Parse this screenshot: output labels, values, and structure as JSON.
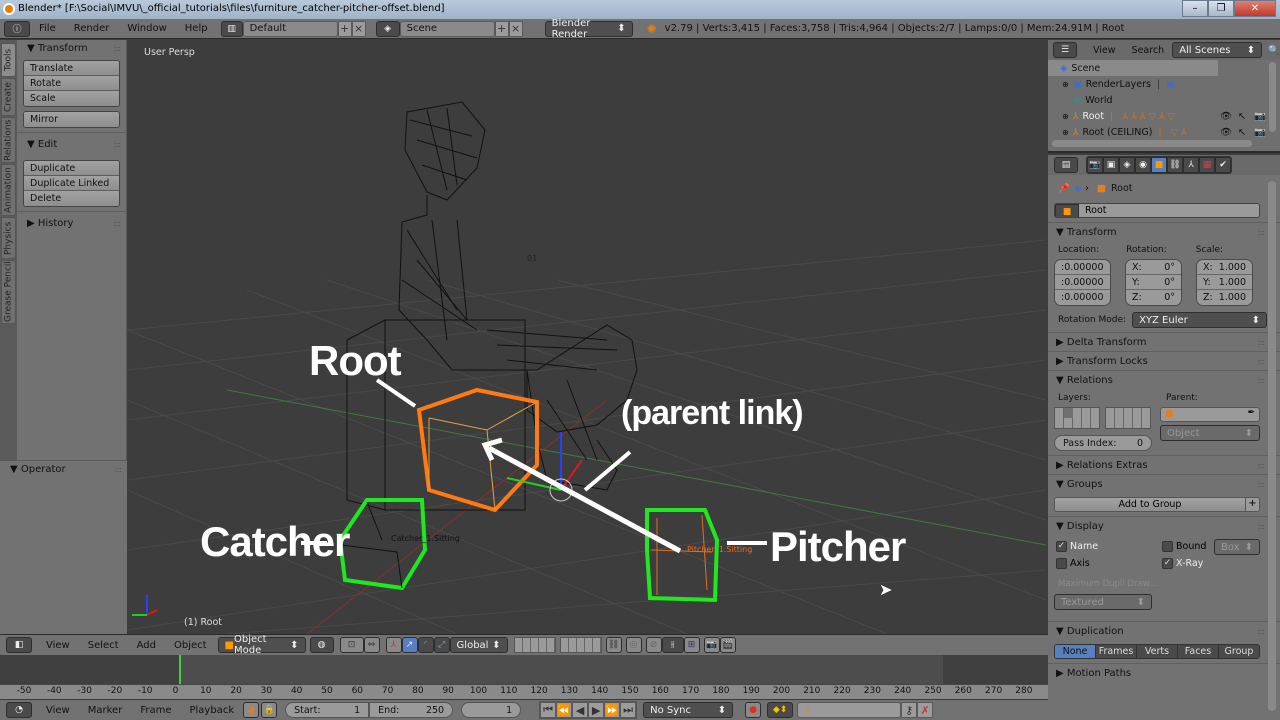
{
  "window": {
    "title": "Blender* [F:\\Social\\IMVU\\_official_tutorials\\files\\furniture_catcher-pitcher-offset.blend]",
    "minimize": "–",
    "restore": "❐",
    "close": "✕"
  },
  "topbar": {
    "menus": [
      "File",
      "Render",
      "Window",
      "Help"
    ],
    "layout": "Default",
    "scene": "Scene",
    "engine": "Blender Render",
    "stats": "v2.79 | Verts:3,415 | Faces:3,758 | Tris:4,964 | Objects:2/7 | Lamps:0/0 | Mem:24.91M | Root"
  },
  "toolshelf": {
    "tabs": [
      "Tools",
      "Create",
      "Relations",
      "Animation",
      "Physics",
      "Grease Pencil"
    ],
    "transform": {
      "title": "Transform",
      "buttons": [
        "Translate",
        "Rotate",
        "Scale"
      ],
      "mirror": "Mirror"
    },
    "edit": {
      "title": "Edit",
      "buttons": [
        "Duplicate",
        "Duplicate Linked",
        "Delete"
      ]
    },
    "history": "History",
    "operator": "Operator"
  },
  "viewport": {
    "view_name": "User Persp",
    "active_object": "(1) Root",
    "labels": {
      "catcher_obj": "Catcher_1.Sitting",
      "pitcher_obj": "Pitcher_1.Sitting",
      "seat_obj": "01"
    },
    "annotations": {
      "root": "Root",
      "parent_link": "(parent link)",
      "catcher": "Catcher",
      "pitcher": "Pitcher"
    },
    "colors": {
      "root_box": "#ff7a12",
      "node_box": "#1ee81e",
      "arrow": "#ffffff"
    }
  },
  "outliner": {
    "menus": [
      "View",
      "Search"
    ],
    "filter": "All Scenes",
    "items": [
      {
        "label": "Scene"
      },
      {
        "label": "RenderLayers"
      },
      {
        "label": "World"
      },
      {
        "label": "Root"
      },
      {
        "label": "Root (CEILING)"
      }
    ]
  },
  "properties": {
    "breadcrumb": "Root",
    "object_name": "Root",
    "transform": {
      "title": "Transform",
      "location_label": "Location:",
      "rotation_label": "Rotation:",
      "scale_label": "Scale:",
      "location": [
        ":0.00000",
        ":0.00000",
        ":0.00000"
      ],
      "rotation": [
        {
          "axis": "X:",
          "value": "0°"
        },
        {
          "axis": "Y:",
          "value": "0°"
        },
        {
          "axis": "Z:",
          "value": "0°"
        }
      ],
      "scale": [
        {
          "axis": "X:",
          "value": "1.000"
        },
        {
          "axis": "Y:",
          "value": "1.000"
        },
        {
          "axis": "Z:",
          "value": "1.000"
        }
      ],
      "rotation_mode_label": "Rotation Mode:",
      "rotation_mode": "XYZ Euler"
    },
    "sections": {
      "delta": "Delta Transform",
      "locks": "Transform Locks",
      "relations": "Relations",
      "relations_extras": "Relations Extras",
      "groups": "Groups",
      "display": "Display",
      "duplication": "Duplication",
      "motion_paths": "Motion Paths"
    },
    "relations": {
      "layers_label": "Layers:",
      "parent_label": "Parent:",
      "parent_type": "Object",
      "pass_index_label": "Pass Index:",
      "pass_index": "0"
    },
    "groups": {
      "add": "Add to Group"
    },
    "display": {
      "name": "Name",
      "name_checked": true,
      "axis": "Axis",
      "axis_checked": false,
      "bound": "Bound",
      "bound_checked": false,
      "bound_type": "Box",
      "xray": "X-Ray",
      "xray_checked": true,
      "max_dupli": "Maximum Dupli Draw...",
      "draw_type": "Textured"
    },
    "duplication": {
      "options": [
        "None",
        "Frames",
        "Verts",
        "Faces",
        "Group"
      ],
      "selected": "None"
    }
  },
  "viewport_header": {
    "menus": [
      "View",
      "Select",
      "Add",
      "Object"
    ],
    "mode": "Object Mode",
    "orientation": "Global"
  },
  "timeline": {
    "ruler": [
      "-50",
      "-40",
      "-30",
      "-20",
      "-10",
      "0",
      "10",
      "20",
      "30",
      "40",
      "50",
      "60",
      "70",
      "80",
      "90",
      "100",
      "110",
      "120",
      "130",
      "140",
      "150",
      "160",
      "170",
      "180",
      "190",
      "200",
      "210",
      "220",
      "230",
      "240",
      "250",
      "260",
      "270",
      "280"
    ],
    "menus": [
      "View",
      "Marker",
      "Frame",
      "Playback"
    ],
    "start_label": "Start:",
    "start": "1",
    "end_label": "End:",
    "end": "250",
    "current": "1",
    "sync": "No Sync"
  }
}
